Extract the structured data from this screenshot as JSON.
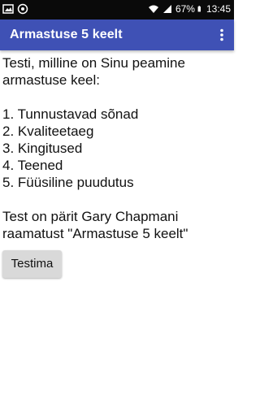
{
  "status_bar": {
    "battery": "67%",
    "time": "13:45",
    "icons": [
      "image-icon",
      "notification-icon",
      "wifi-icon",
      "signal-icon",
      "battery-icon"
    ]
  },
  "app_bar": {
    "title": "Armastuse 5 keelt",
    "menu_icon": "more-vert-icon",
    "color": "#3f51b5"
  },
  "intro": {
    "line1": "Testi, milline on Sinu peamine",
    "line2": "armastuse keel:"
  },
  "languages": [
    "1. Tunnustavad sõnad",
    "2. Kvaliteetaeg",
    "3. Kingitused",
    "4. Teened",
    "5. Füüsiline puudutus"
  ],
  "source": {
    "line1": "Test on pärit Gary Chapmani",
    "line2": "raamatust \"Armastuse 5 keelt\""
  },
  "button": {
    "label": "Testima"
  }
}
